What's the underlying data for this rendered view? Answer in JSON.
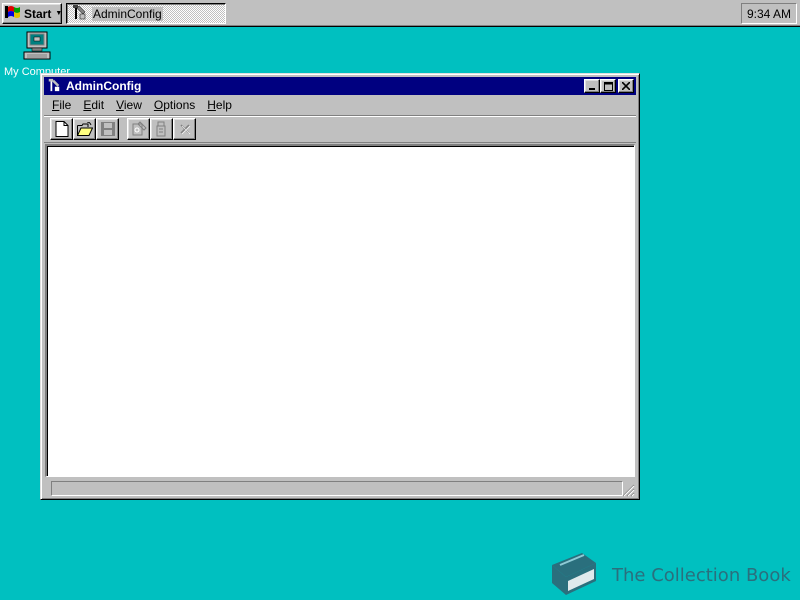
{
  "taskbar": {
    "start_label": "Start",
    "task_label": "AdminConfig",
    "clock": "9:34 AM"
  },
  "desktop": {
    "icons": [
      {
        "label": "My Computer",
        "icon": "computer-icon"
      }
    ]
  },
  "window": {
    "title": "AdminConfig",
    "menu": [
      {
        "label": "File",
        "accel": "F"
      },
      {
        "label": "Edit",
        "accel": "E"
      },
      {
        "label": "View",
        "accel": "V"
      },
      {
        "label": "Options",
        "accel": "O"
      },
      {
        "label": "Help",
        "accel": "H"
      }
    ],
    "toolbar": [
      {
        "icon": "new-document-icon",
        "enabled": true
      },
      {
        "icon": "open-folder-icon",
        "enabled": true
      },
      {
        "icon": "save-icon",
        "enabled": false
      },
      {
        "icon": "properties-icon",
        "enabled": false
      },
      {
        "icon": "copy-icon",
        "enabled": false
      },
      {
        "icon": "delete-icon",
        "enabled": false
      }
    ],
    "status_text": ""
  },
  "watermark": {
    "text": "The Collection Book",
    "color": "#2a6f7d"
  },
  "colors": {
    "desktop": "#00c0c0",
    "titlebar": "#000080",
    "face": "#c0c0c0"
  }
}
